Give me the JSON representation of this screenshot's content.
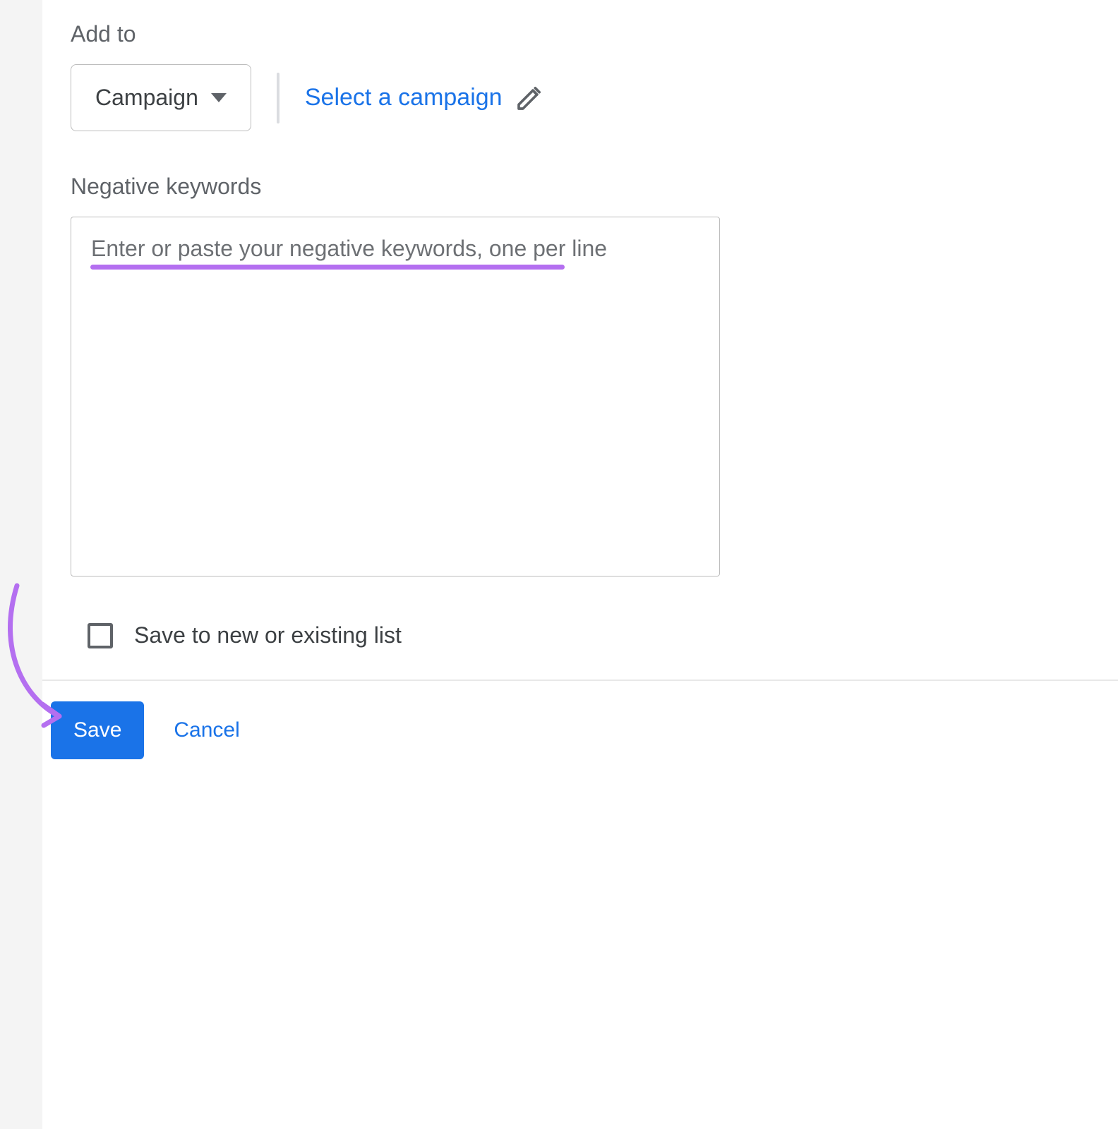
{
  "addto": {
    "label": "Add to",
    "dropdown_value": "Campaign",
    "select_campaign_label": "Select a campaign"
  },
  "negative_keywords": {
    "label": "Negative keywords",
    "placeholder": "Enter or paste your negative keywords, one per line",
    "value": ""
  },
  "save_to_list": {
    "checked": false,
    "label": "Save to new or existing list"
  },
  "footer": {
    "save_label": "Save",
    "cancel_label": "Cancel"
  },
  "colors": {
    "accent": "#1a73e8",
    "annotation": "#b46ff0",
    "text_muted": "#5f6368"
  }
}
